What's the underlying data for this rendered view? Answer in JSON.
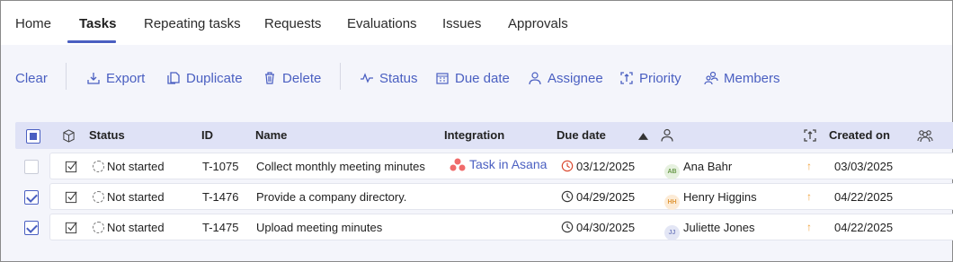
{
  "tabs": [
    {
      "label": "Home"
    },
    {
      "label": "Tasks"
    },
    {
      "label": "Repeating tasks"
    },
    {
      "label": "Requests"
    },
    {
      "label": "Evaluations"
    },
    {
      "label": "Issues"
    },
    {
      "label": "Approvals"
    }
  ],
  "toolbar": {
    "clear": "Clear",
    "export": "Export",
    "duplicate": "Duplicate",
    "delete": "Delete",
    "status": "Status",
    "due_date": "Due date",
    "assignee": "Assignee",
    "priority": "Priority",
    "members": "Members"
  },
  "table": {
    "headers": {
      "status": "Status",
      "id": "ID",
      "name": "Name",
      "integration": "Integration",
      "due_date": "Due date",
      "created_on": "Created on"
    },
    "rows": [
      {
        "checked": false,
        "status": "Not started",
        "id": "T-1075",
        "name": "Collect monthly meeting minutes",
        "integration": "Task in Asana",
        "due_date": "03/12/2025",
        "due_color": "#d9442a",
        "assignee_initials": "AB",
        "assignee": "Ana Bahr",
        "avatar_bg": "#e6f1df",
        "avatar_fg": "#6a9a4a",
        "created_on": "03/03/2025"
      },
      {
        "checked": true,
        "status": "Not started",
        "id": "T-1476",
        "name": "Provide a company directory.",
        "integration": "",
        "due_date": "04/29/2025",
        "due_color": "#333333",
        "assignee_initials": "HH",
        "assignee": "Henry Higgins",
        "avatar_bg": "#fcebd6",
        "avatar_fg": "#e09a3e",
        "created_on": "04/22/2025"
      },
      {
        "checked": true,
        "status": "Not started",
        "id": "T-1475",
        "name": "Upload meeting minutes",
        "integration": "",
        "due_date": "04/30/2025",
        "due_color": "#333333",
        "assignee_initials": "JJ",
        "assignee": "Juliette Jones",
        "avatar_bg": "#e3e6f5",
        "avatar_fg": "#7f89c4",
        "created_on": "04/22/2025"
      }
    ]
  },
  "colors": {
    "accent": "#4a5fc1",
    "header_bg": "#dfe2f6",
    "priority": "#f0a23a"
  }
}
